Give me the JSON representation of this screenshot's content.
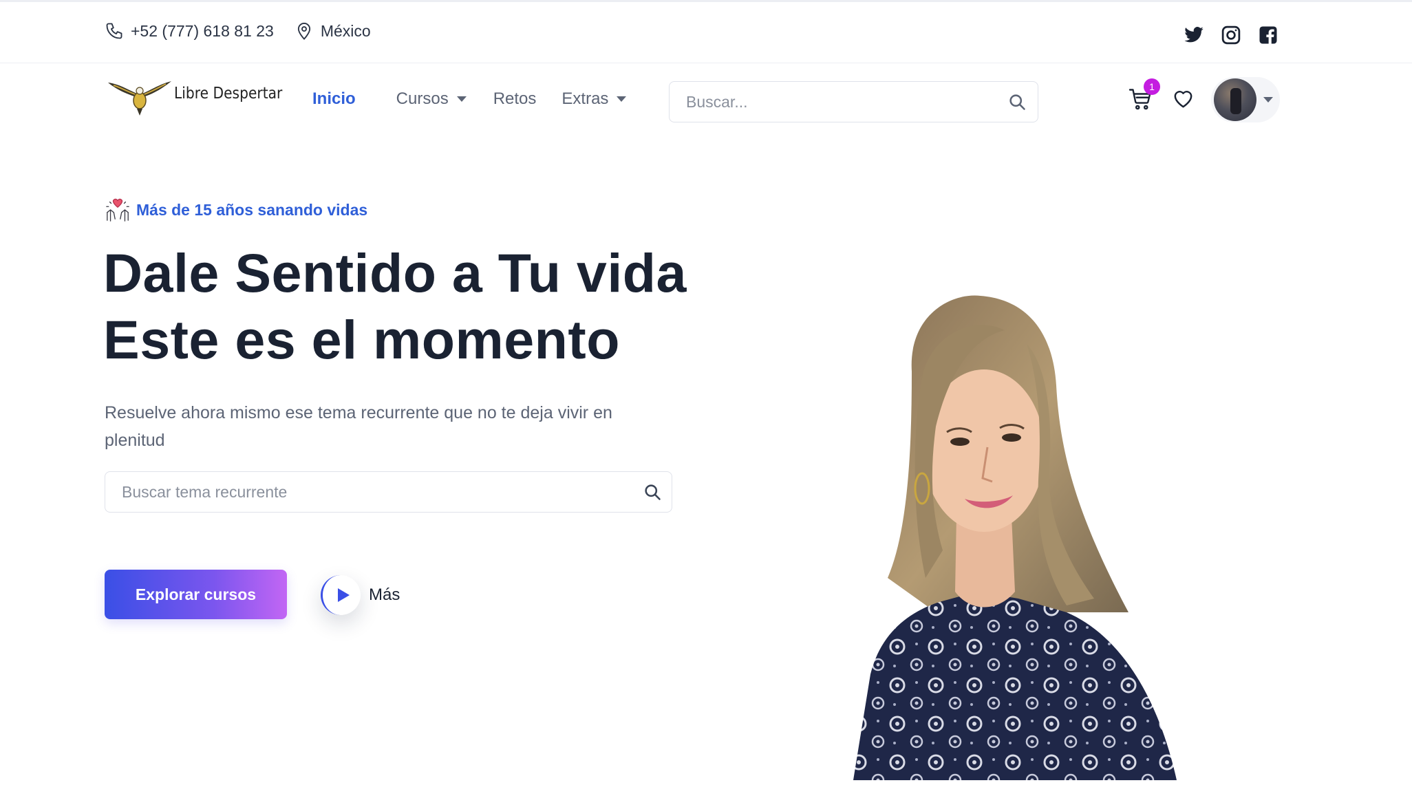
{
  "topbar": {
    "phone": "+52 (777) 618 81 23",
    "location": "México",
    "social_icons": [
      "twitter-icon",
      "instagram-icon",
      "facebook-icon"
    ]
  },
  "nav": {
    "brand": "Libre Despertar",
    "menu": [
      {
        "label": "Inicio",
        "active": true
      },
      {
        "label": "Cursos",
        "dropdown": true
      },
      {
        "label": "Retos"
      },
      {
        "label": "Extras",
        "dropdown": true
      }
    ],
    "search_placeholder": "Buscar...",
    "cart_count": "1"
  },
  "hero": {
    "tagline": "Más de 15 años sanando vidas",
    "headline_line1": "Dale Sentido a Tu vida",
    "headline_line2": "Este es el momento",
    "subtitle": "Resuelve ahora mismo ese tema recurrente que no te deja vivir en plenitud",
    "search_placeholder": "Buscar tema recurrente",
    "cta_label": "Explorar cursos",
    "more_label": "Más"
  },
  "colors": {
    "accent": "#2f5fd8",
    "heading": "#1a2232",
    "cta_gradient_start": "#3a4fe6",
    "cta_gradient_end": "#c266f4",
    "badge": "#c41de0"
  }
}
